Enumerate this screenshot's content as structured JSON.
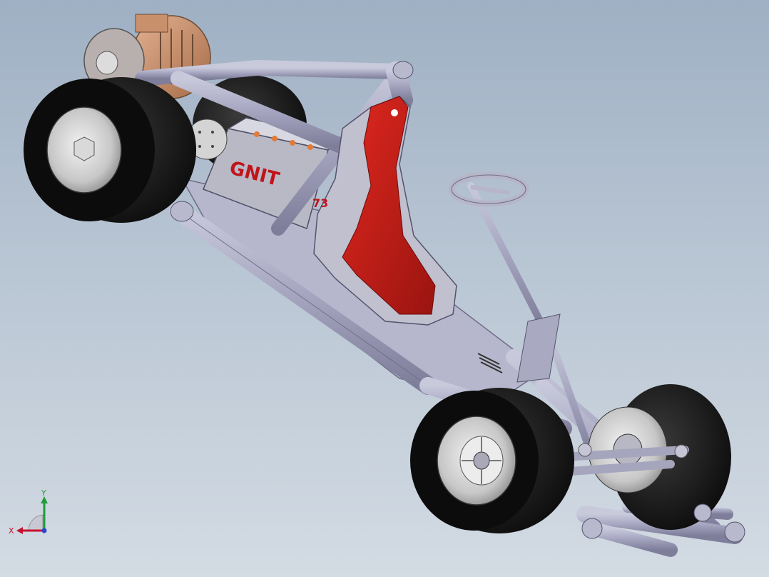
{
  "app": {
    "view_name": "isometric-3d-view"
  },
  "model": {
    "battery_label": "GNIT",
    "seat_number": "73"
  },
  "triad": {
    "x_label": "X",
    "y_label": "Y",
    "x_color": "#c8102e",
    "y_color": "#1f9d3a",
    "z_color": "#2f44c8"
  },
  "colors": {
    "background_top": "#9fb0c4",
    "background_bottom": "#d3dbe3",
    "frame_tube": "#a9a9c4",
    "seat_red": "#c8211b",
    "tire": "#151515",
    "rim": "#d6d6d6",
    "motor_copper": "#c98f6a"
  }
}
